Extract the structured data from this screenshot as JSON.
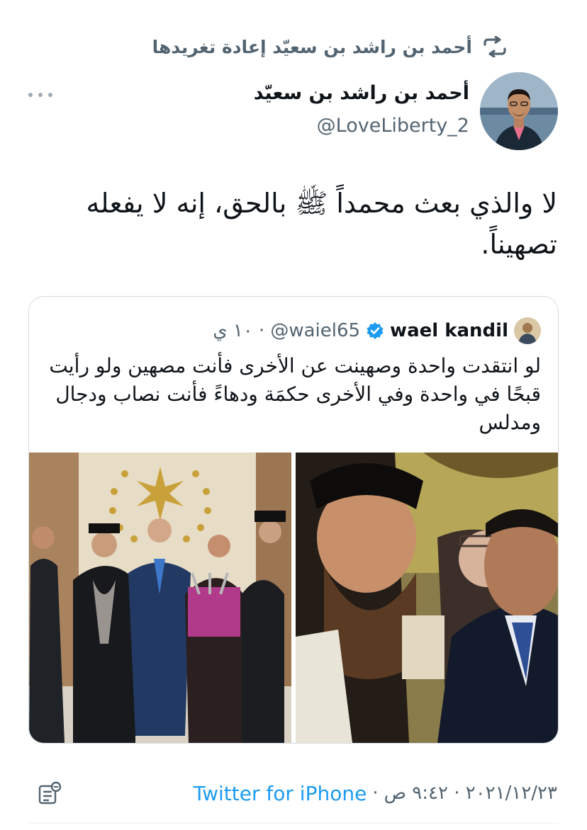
{
  "retweet": {
    "text": "أحمد بن راشد بن سعيّد إعادة تغريدها"
  },
  "author": {
    "name": "أحمد بن راشد بن سعيّد",
    "handle": "@LoveLiberty_2"
  },
  "tweet": {
    "text": "لا والذي بعث محمداً ﷺ بالحق، إنه لا يفعله تصهيناً."
  },
  "quoted": {
    "name": "wael kandil",
    "handle": "@waiel65",
    "time": "· ١٠ ي",
    "text": "لو انتقدت واحدة وصهينت عن الأخرى فأنت مصهين ولو رأيت قبحًا في واحدة وفي الأخرى حكمَة ودهاءً فأنت نصاب ودجال ومدلس"
  },
  "footer": {
    "date": "٢٠٢١/١٢/٢٣ · ٩:٤٢ ص",
    "source": "Twitter for iPhone"
  },
  "colors": {
    "accent": "#1d9bf0",
    "secondary": "#536471",
    "text": "#0f1419",
    "border": "#d3dbe1"
  },
  "icons": [
    "retweet-icon",
    "more-icon",
    "verified-icon",
    "analytics-icon"
  ]
}
